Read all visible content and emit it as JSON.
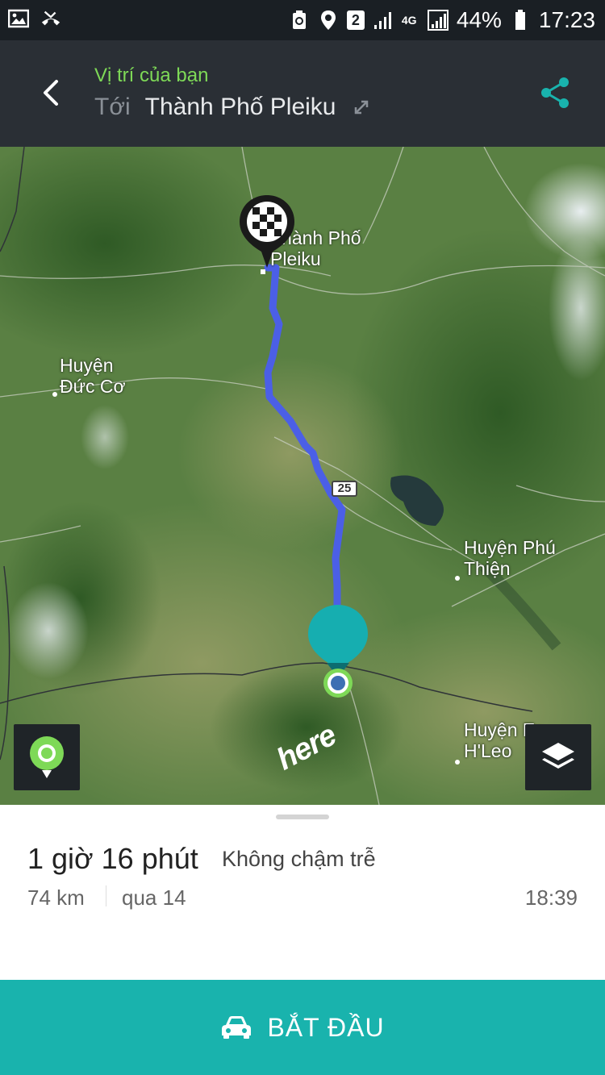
{
  "status_bar": {
    "battery": "44%",
    "time": "17:23",
    "sim_slot": "2",
    "network": "4G",
    "icons": [
      "image-icon",
      "missed-call-icon",
      "recycle-icon",
      "location-icon",
      "sim-icon",
      "signal-icon",
      "signal-icon",
      "battery-icon"
    ]
  },
  "header": {
    "from": "Vị trí của bạn",
    "to_prefix": "Tới",
    "destination": "Thành Phố Pleiku"
  },
  "map": {
    "labels": {
      "pleiku": "Thành Phố\nPleiku",
      "duc_co": "Huyện\nĐức Cơ",
      "phu_thien": "Huyện Phú\nThiện",
      "ea_h_leo": "Huyện Ea\nH'Leo"
    },
    "route_shield": "25",
    "provider_logo": "here",
    "route_color": "#4b5fe6",
    "origin_color": "#16aeb0",
    "location_color": "#7ed957"
  },
  "summary": {
    "duration": "1 giờ 16 phút",
    "traffic": "Không chậm trễ",
    "distance": "74 km",
    "via": "qua 14",
    "eta": "18:39"
  },
  "actions": {
    "start": "BẮT ĐẦU"
  }
}
